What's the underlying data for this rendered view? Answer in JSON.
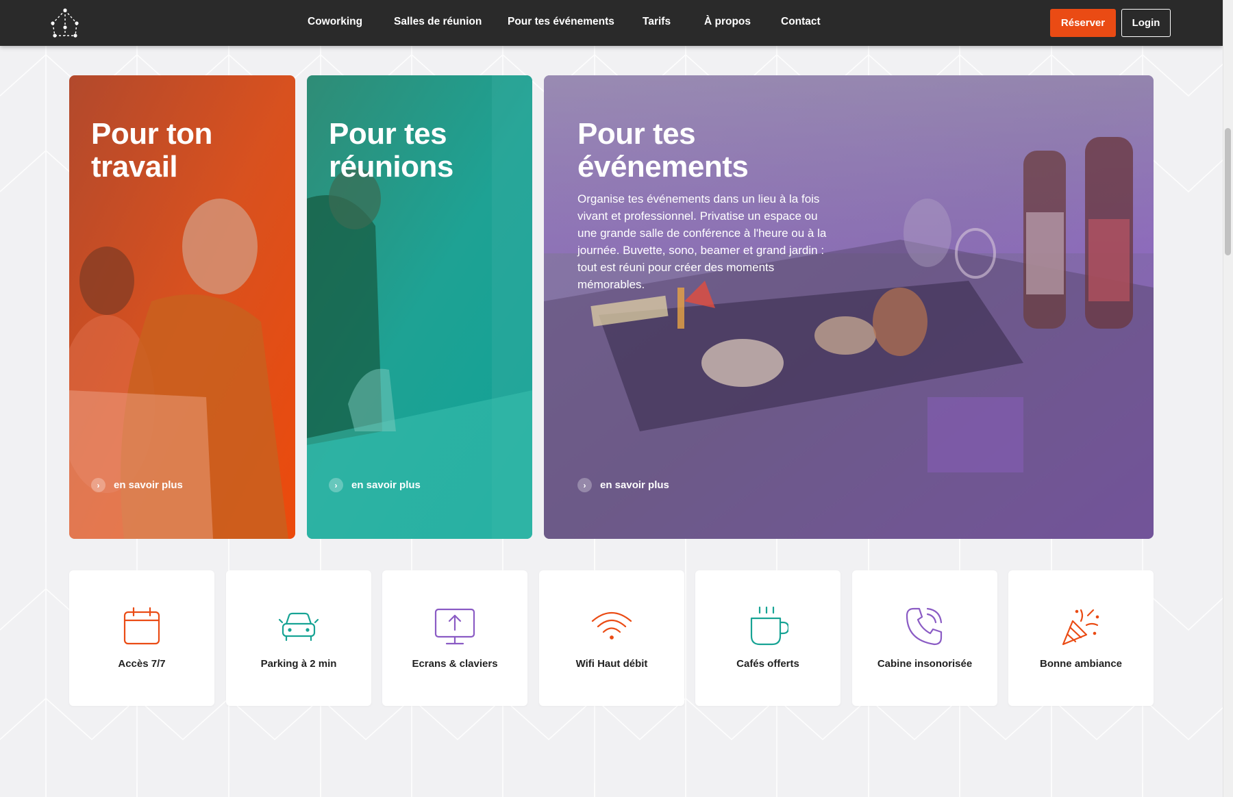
{
  "header": {
    "nav": [
      "Coworking",
      "Salles de réunion",
      "Pour tes événements",
      "Tarifs",
      "À propos",
      "Contact"
    ],
    "reserve_label": "Réserver",
    "login_label": "Login"
  },
  "cards": [
    {
      "title_line1": "Pour ton",
      "title_line2": "travail",
      "more": "en savoir plus",
      "color": "#ea4b14"
    },
    {
      "title_line1": "Pour tes",
      "title_line2": "réunions",
      "more": "en savoir plus",
      "color": "#17a394"
    },
    {
      "title_line1": "Pour tes",
      "title_line2": "événements",
      "description_lines": [
        "Organise tes événements dans un lieu à la fois",
        "vivant et professionnel. Privatise un espace ou",
        "une grande salle de conférence à l'heure ou à la",
        "journée. Buvette, sono, beamer et grand jardin :",
        "tout est réuni pour créer des moments",
        "mémorables."
      ],
      "more": "en savoir plus",
      "color": "#8a5bc4"
    }
  ],
  "features": [
    {
      "label": "Accès 7/7",
      "icon": "calendar-icon",
      "color": "#ea4b14"
    },
    {
      "label": "Parking à 2 min",
      "icon": "car-icon",
      "color": "#17a394"
    },
    {
      "label": "Ecrans & claviers",
      "icon": "monitor-icon",
      "color": "#8a5bc4"
    },
    {
      "label": "Wifi Haut débit",
      "icon": "wifi-icon",
      "color": "#ea4b14"
    },
    {
      "label": "Cafés offerts",
      "icon": "coffee-icon",
      "color": "#17a394"
    },
    {
      "label": "Cabine insonorisée",
      "icon": "phone-icon",
      "color": "#8a5bc4"
    },
    {
      "label": "Bonne ambiance",
      "icon": "party-popper-icon",
      "color": "#ea4b14"
    }
  ]
}
